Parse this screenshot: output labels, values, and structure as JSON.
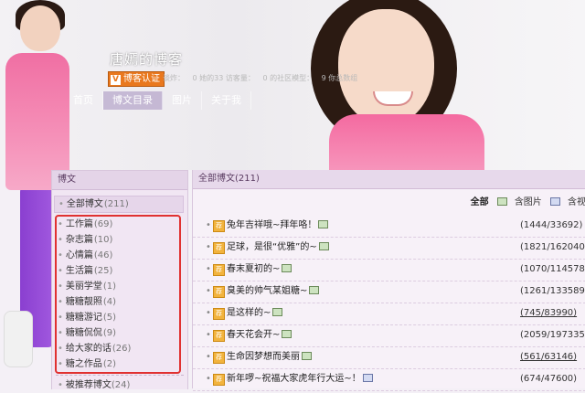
{
  "blog": {
    "title": "唐嫣的博客",
    "verify_label": "博客认证",
    "meta": [
      "谈炸：",
      "0 她的33 访客量：",
      "0 的社区模型：",
      "9 你总数组"
    ]
  },
  "nav": [
    {
      "label": "首页",
      "active": false
    },
    {
      "label": "博文目录",
      "active": true
    },
    {
      "label": "图片",
      "active": false
    },
    {
      "label": "关于我",
      "active": false
    }
  ],
  "left": {
    "header": "博文",
    "all": {
      "label": "全部博文",
      "count": "(211)"
    },
    "categories": [
      {
        "label": "工作篇",
        "count": "(69)"
      },
      {
        "label": "杂志篇",
        "count": "(10)"
      },
      {
        "label": "心情篇",
        "count": "(46)"
      },
      {
        "label": "生活篇",
        "count": "(25)"
      },
      {
        "label": "美丽学堂",
        "count": "(1)"
      },
      {
        "label": "糖糖靓照",
        "count": "(4)"
      },
      {
        "label": "糖糖游记",
        "count": "(5)"
      },
      {
        "label": "糖糖侃侃",
        "count": "(9)"
      },
      {
        "label": "给大家的话",
        "count": "(26)"
      },
      {
        "label": "糖之作品",
        "count": "(2)"
      }
    ],
    "recommended": {
      "label": "被推荐博文",
      "count": "(24)"
    }
  },
  "right": {
    "header": "全部博文(211)",
    "filters": {
      "all": "全部",
      "with_images": "含图片",
      "with_video": "含视"
    },
    "posts": [
      {
        "title": "兔年吉祥哦~拜年咯！",
        "has_image": true,
        "stats": "(1444/33692)",
        "underline": false
      },
      {
        "title": "足球，是很“优雅”的~",
        "has_image": true,
        "stats": "(1821/162040)",
        "underline": false
      },
      {
        "title": "春末夏初的~",
        "has_image": true,
        "stats": "(1070/114578)",
        "underline": false
      },
      {
        "title": "臭美的帅气某姐糖~",
        "has_image": true,
        "stats": "(1261/133589)",
        "underline": false
      },
      {
        "title": "是这样的~",
        "has_image": true,
        "stats": "(745/83990)",
        "underline": true
      },
      {
        "title": "春天花会开~",
        "has_image": true,
        "stats": "(2059/197335)",
        "underline": false
      },
      {
        "title": "生命因梦想而美丽",
        "has_image": true,
        "stats": "(561/63146)",
        "underline": true
      },
      {
        "title": "新年啰~祝福大家虎年行大运~！",
        "has_image": true,
        "stats": "(674/47600)",
        "underline": false
      }
    ]
  },
  "colors": {
    "highlight_box": "#e03131",
    "badge": "#e9781e",
    "panel": "#f1e6f3"
  }
}
